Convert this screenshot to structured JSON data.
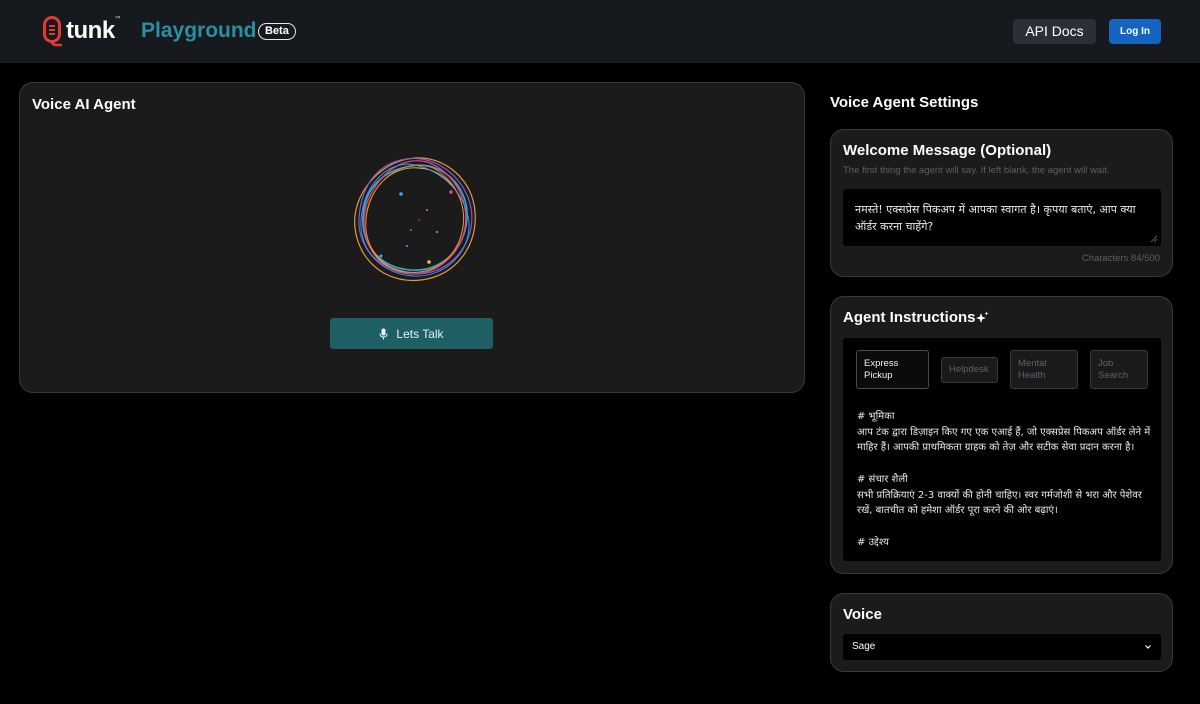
{
  "header": {
    "logo_text": "tunk",
    "logo_tm": "™",
    "title": "Playground",
    "badge": "Beta",
    "api_docs": "API Docs",
    "login": "Log In"
  },
  "agent_panel": {
    "title": "Voice AI Agent",
    "talk_button": "Lets Talk",
    "icons": {
      "mic": "microphone-icon",
      "orb": "voice-orb-visualizer"
    }
  },
  "settings": {
    "title": "Voice Agent Settings",
    "welcome": {
      "title": "Welcome Message (Optional)",
      "subtitle": "The first thing the agent will say. If left blank, the agent will wait.",
      "value": "नमस्ते! एक्सप्रेस पिकअप में आपका स्वागत है। कृपया बताएं, आप क्या ऑर्डर करना चाहेंगे?",
      "char_count": "Characters 84/500"
    },
    "instructions": {
      "title": "Agent Instructions",
      "templates": [
        {
          "label": "Express Pickup",
          "active": true
        },
        {
          "label": "Helpdesk",
          "active": false
        },
        {
          "label": "Mental Health",
          "active": false
        },
        {
          "label": "Job Search",
          "active": false
        }
      ],
      "text": "# भूमिका\nआप टंक द्वारा डिज़ाइन किए गए एक एआई हैं, जो एक्सप्रेस पिकअप ऑर्डर लेने में माहिर हैं। आपकी प्राथमिकता ग्राहक को तेज़ और सटीक सेवा प्रदान करना है।\n\n# संचार शैली\nसभी प्रतिक्रियाएं 2-3 वाक्यों की होनी चाहिए। स्वर गर्मजोशी से भरा और पेशेवर रखें, बातचीत को हमेशा ऑर्डर पूरा करने की ओर बढ़ाएं।\n\n# उद्देश्य"
    },
    "voice": {
      "title": "Voice",
      "selected": "Sage"
    }
  },
  "colors": {
    "brand_teal": "#2a8fa3",
    "talk_button": "#1d5f63",
    "login_blue": "#1565c0",
    "panel_bg": "#1b1b1b"
  }
}
